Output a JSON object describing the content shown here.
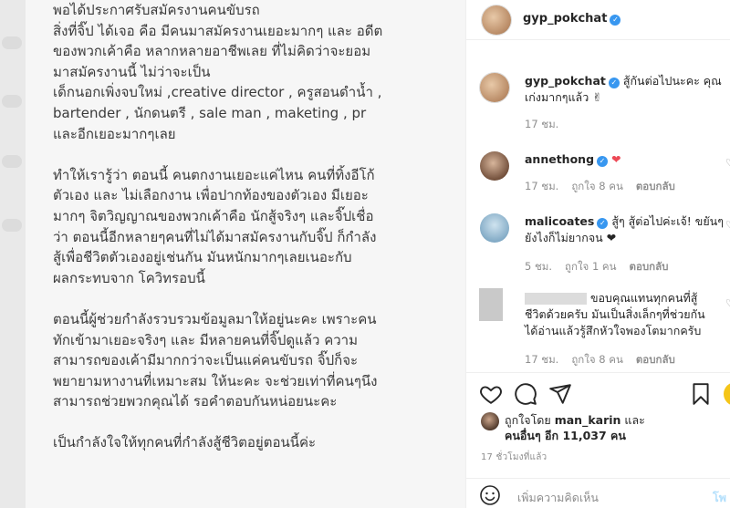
{
  "post": {
    "lines": [
      "พอได้ประกาศรับสมัครงานคนขับรถ",
      "สิ่งที่จิ๊ป ได้เจอ คือ มีคนมาสมัครงานเยอะมากๆ และ อดีต",
      "ของพวกเค้าคือ หลากหลายอาชีพเลย ที่ไม่คิดว่าจะยอม",
      "มาสมัครงานนี้ ไม่ว่าจะเป็น",
      "เด็กนอกเพิ่งจบใหม่ ,creative director , ครูสอนดำน้ำ ,",
      "bartender , นักดนตรี , sale man , maketing , pr",
      "และอีกเยอะมากๆเลย",
      "",
      "ทำให้เรารู้ว่า ตอนนี้ คนตกงานเยอะแค่ไหน คนที่ทิ้งอีโก้",
      "ตัวเอง และ ไม่เลือกงาน เพื่อปากท้องของตัวเอง มีเยอะ",
      "มากๆ จิตวิญญาณของพวกเค้าคือ นักสู้จริงๆ และจิ๊ปเชื่อ",
      "ว่า ตอนนี้อีกหลายๆคนที่ไม่ได้มาสมัครงานกับจิ๊ป ก็กำลัง",
      "สู้เพื่อชีวิตตัวเองอยู่เช่นกัน มันหนักมากๆเลยเนอะกับ",
      "ผลกระทบจาก โควิทรอบนี้",
      "",
      "ตอนนี้ผู้ช่วยกำลังรวบรวมข้อมูลมาให้อยู่นะคะ เพราะคน",
      "ทักเข้ามาเยอะจริงๆ และ มีหลายคนที่จิ๊ปดูแล้ว ความ",
      "สามารถของเค้ามีมากกว่าจะเป็นแค่คนขับรถ จิ๊ปก็จะ",
      "พยายามหางานที่เหมาะสม ให้นะคะ จะช่วยเท่าที่คนๆนึง",
      "สามารถช่วยพวกคุณได้ รอคำตอบกันหน่อยนะคะ",
      "",
      "เป็นกำลังใจให้ทุกคนที่กำลังสู้ชีวิตอยู่ตอนนี้ค่ะ"
    ]
  },
  "header": {
    "username": "gyp_pokchat"
  },
  "comments": [
    {
      "user": "gyp_pokchat",
      "text": "สู้กันต่อไปนะคะ คุณเก่งมากๆแล้ว ✌",
      "time": "17 ชม."
    },
    {
      "user": "annethong",
      "text": "❤",
      "time": "17 ชม.",
      "likes": "ถูกใจ 8 คน",
      "reply": "ตอบกลับ"
    },
    {
      "user": "malicoates",
      "text": "สู้ๆ สู้ต่อไปค่ะเจ้! ขยันๆ ยังไงก็ไม่ยากจน ❤",
      "time": "5 ชม.",
      "likes": "ถูกใจ 1 คน",
      "reply": "ตอบกลับ"
    },
    {
      "user": "",
      "text": "ขอบคุณแทนทุกคนที่สู้ชีวิตด้วยครับ มันเป็นสิ่งเล็กๆที่ช่วยกันได้อ่านแล้วรู้สึกหัวใจพองโตมากครับ",
      "time": "17 ชม.",
      "likes": "ถูกใจ 8 คน",
      "reply": "ตอบกลับ"
    }
  ],
  "likes": {
    "liked_by_prefix": "ถูกใจโดย",
    "liked_by_user": "man_karin",
    "and": "และ",
    "others_label": "คนอื่นๆ อีก 11,037 คน"
  },
  "timestamp": "17 ชั่วโมงที่แล้ว",
  "add_comment": {
    "placeholder": "เพิ่มความคิดเห็น",
    "post_label": "โพ"
  },
  "icons": {
    "like": "heart-outline-icon",
    "comment": "comment-bubble-icon",
    "share": "paper-plane-icon",
    "save": "bookmark-icon",
    "emoji": "smiley-icon"
  },
  "colors": {
    "verified": "#3897f0",
    "heart": "#ed4956",
    "post_disabled": "#b2dffc"
  }
}
